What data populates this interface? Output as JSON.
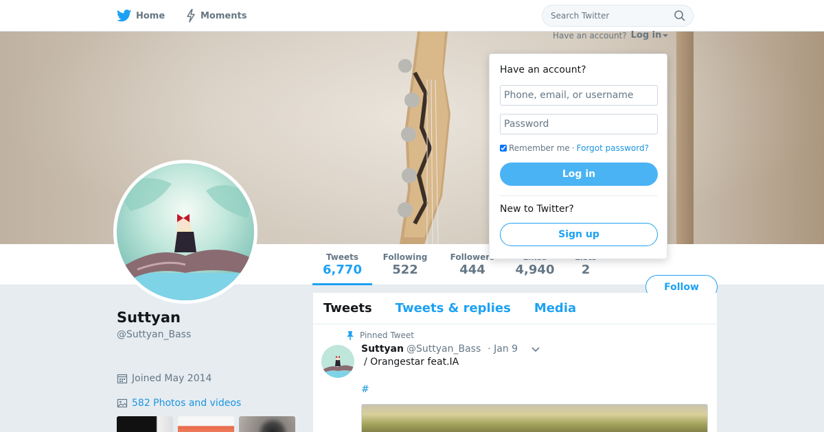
{
  "nav": {
    "home_label": "Home",
    "moments_label": "Moments",
    "search_placeholder": "Search Twitter"
  },
  "login_hint": {
    "text": "Have an account?",
    "link": "Log in"
  },
  "login_dropdown": {
    "title": "Have an account?",
    "username_placeholder": "Phone, email, or username",
    "password_placeholder": "Password",
    "remember_label": "Remember me",
    "separator": "·",
    "forgot_label": "Forgot password?",
    "login_button": "Log in",
    "new_label": "New to Twitter?",
    "signup_button": "Sign up"
  },
  "profile": {
    "name": "Suttyan",
    "handle": "@Suttyan_Bass",
    "joined": "Joined May 2014",
    "photos": "582 Photos and videos",
    "follow_label": "Follow"
  },
  "stats": [
    {
      "label": "Tweets",
      "value": "6,770"
    },
    {
      "label": "Following",
      "value": "522"
    },
    {
      "label": "Followers",
      "value": "444"
    },
    {
      "label": "Likes",
      "value": "4,940"
    },
    {
      "label": "Lists",
      "value": "2"
    }
  ],
  "timeline": {
    "tabs": [
      "Tweets",
      "Tweets & replies",
      "Media"
    ],
    "pinned_label": "Pinned Tweet",
    "tweet": {
      "name": "Suttyan",
      "handle": "@Suttyan_Bass",
      "date": "· Jan 9",
      "text": "/ Orangestar feat.IA",
      "hashtag": "#"
    }
  },
  "colors": {
    "accent": "#1da1f2",
    "link": "#1b95e0",
    "background": "#e6ecf0",
    "login_button": "#4ab3f4"
  },
  "icons": {
    "home": "twitter-bird-icon",
    "moments": "lightning-icon",
    "search": "search-icon",
    "calendar": "calendar-icon",
    "photos": "image-icon",
    "pin": "pin-icon",
    "tweet_menu": "chevron-down-icon"
  }
}
